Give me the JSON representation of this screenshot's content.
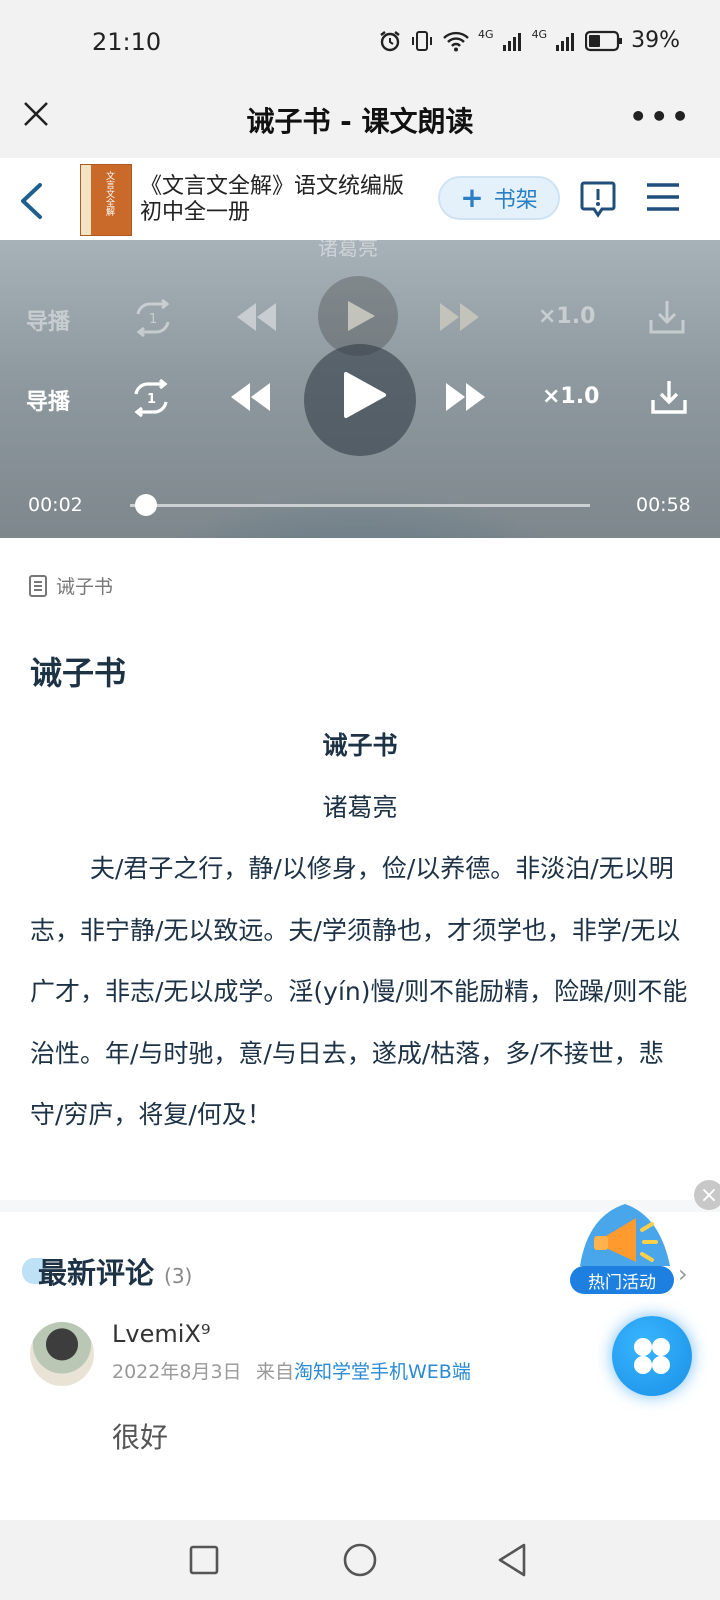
{
  "status_bar": {
    "time": "21:10",
    "network_1": "4G",
    "network_2": "4G",
    "battery": "39%"
  },
  "header": {
    "title": "诫子书 - 课文朗读"
  },
  "book": {
    "title": "《文言文全解》语文统编版初中全一册",
    "shelf_label": "书架"
  },
  "player": {
    "ghost_author": "诸葛亮",
    "guide_label": "导播",
    "speed": "×1.0",
    "current_time": "00:02",
    "total_time": "00:58",
    "progress": 0.034
  },
  "article": {
    "breadcrumb": "诫子书",
    "heading": "诫子书",
    "sub_title": "诫子书",
    "author": "诸葛亮",
    "body": "夫/君子之行，静/以修身，俭/以养德。非淡泊/无以明志，非宁静/无以致远。夫/学须静也，才须学也，非学/无以广才，非志/无以成学。淫(yín)慢/则不能励精，险躁/则不能治性。年/与时驰，意/与日去，遂成/枯落，多/不接世，悲守/穷庐，将复/何及！"
  },
  "comments": {
    "title": "最新评论",
    "count": "(3)",
    "items": [
      {
        "username": "LvemiX⁹",
        "date": "2022年8月3日",
        "source_prefix": "来自",
        "source": "淘知学堂手机WEB端",
        "text": "很好"
      }
    ]
  },
  "promo": {
    "label": "热门活动"
  },
  "colors": {
    "accent": "#2a8ad4",
    "text_dark": "#1e3246"
  }
}
